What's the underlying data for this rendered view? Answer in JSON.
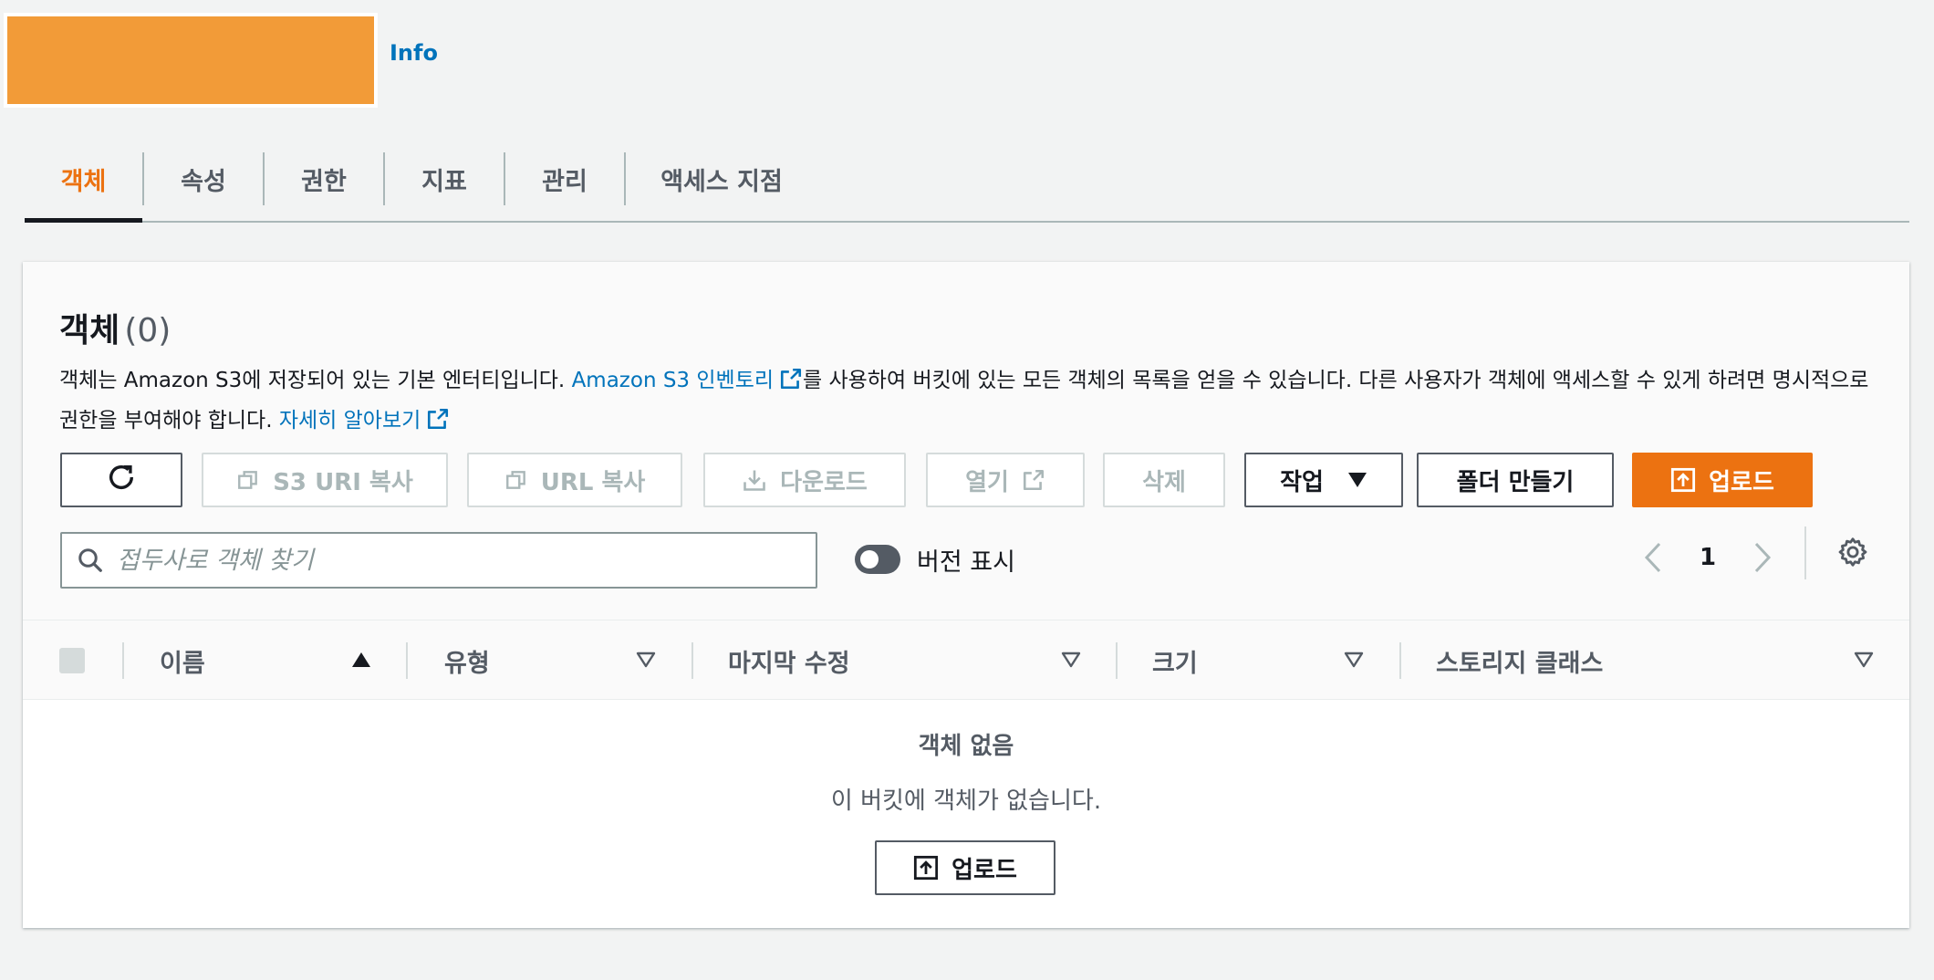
{
  "header": {
    "info_link": "Info"
  },
  "tabs": [
    {
      "label": "객체",
      "active": true
    },
    {
      "label": "속성",
      "active": false
    },
    {
      "label": "권한",
      "active": false
    },
    {
      "label": "지표",
      "active": false
    },
    {
      "label": "관리",
      "active": false
    },
    {
      "label": "액세스 지점",
      "active": false
    }
  ],
  "objects_panel": {
    "title": "객체",
    "count": "(0)",
    "description": {
      "part1": "객체는 Amazon S3에 저장되어 있는 기본 엔터티입니다. ",
      "inventory_link": "Amazon S3 인벤토리",
      "part2": "를 사용하여 버킷에 있는 모든 객체의 목록을 얻을 수 있습니다. 다른 사용자가 객체에 액세스할 수 있게 하려면 명시적으로 권한을 부여해야 합니다. ",
      "learn_more_link": "자세히 알아보기"
    }
  },
  "toolbar": {
    "copy_s3_uri": "S3 URI 복사",
    "copy_url": "URL 복사",
    "download": "다운로드",
    "open": "열기",
    "delete": "삭제",
    "actions": "작업",
    "create_folder": "폴더 만들기",
    "upload": "업로드"
  },
  "search": {
    "placeholder": "접두사로 객체 찾기",
    "value": ""
  },
  "show_versions": {
    "label": "버전 표시",
    "on": false
  },
  "pagination": {
    "current_page": "1"
  },
  "table": {
    "columns": [
      "이름",
      "유형",
      "마지막 수정",
      "크기",
      "스토리지 클래스"
    ],
    "sorted_column": "이름",
    "sort_direction": "ascending",
    "rows": []
  },
  "empty_state": {
    "title": "객체 없음",
    "description": "이 버킷에 객체가 없습니다.",
    "upload_button": "업로드"
  },
  "colors": {
    "accent": "#ec7211",
    "link": "#0073bb",
    "redacted_block": "#f29b38"
  }
}
